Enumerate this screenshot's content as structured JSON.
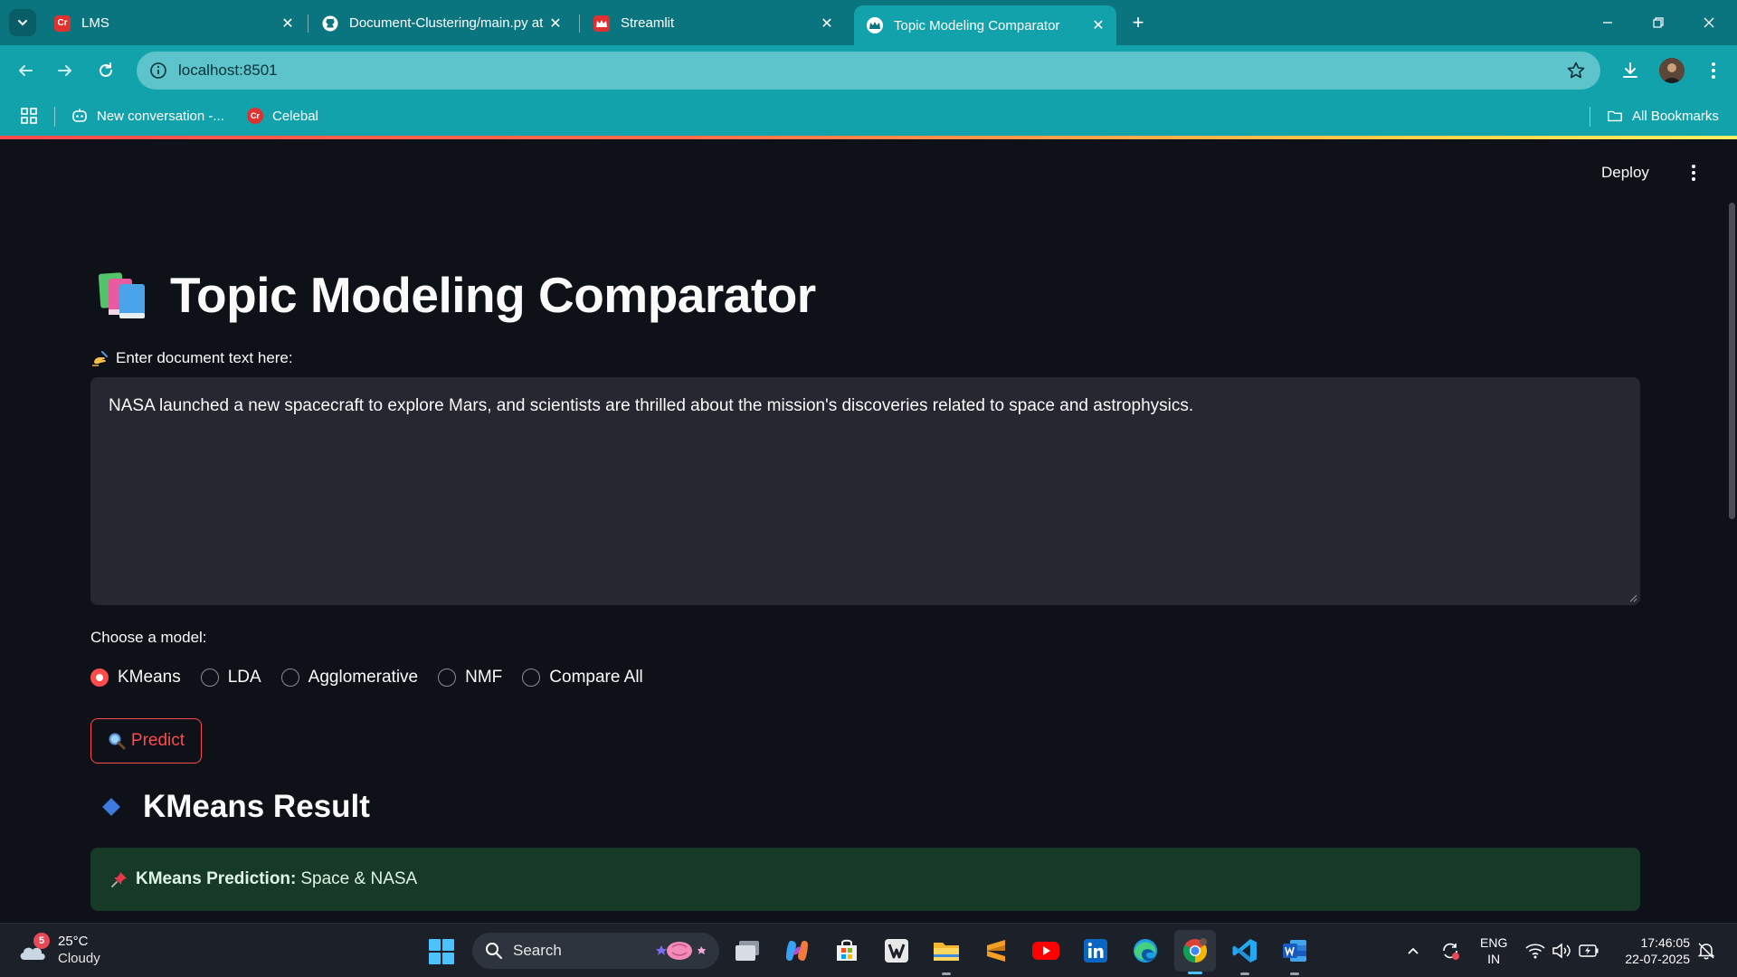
{
  "browser": {
    "tabs": [
      {
        "title": "LMS",
        "active": false
      },
      {
        "title": "Document-Clustering/main.py at",
        "active": false
      },
      {
        "title": "Streamlit",
        "active": false
      },
      {
        "title": "Topic Modeling Comparator",
        "active": true
      }
    ],
    "url": "localhost:8501",
    "bookmarks": [
      {
        "label": "New conversation -..."
      },
      {
        "label": "Celebal"
      }
    ],
    "all_bookmarks_label": "All Bookmarks",
    "favicon_text": "Cr"
  },
  "app": {
    "deploy_label": "Deploy",
    "title": "Topic Modeling Comparator",
    "input_label": "Enter document text here:",
    "input_value": "NASA launched a new spacecraft to explore Mars, and scientists are thrilled about the mission's discoveries related to space and astrophysics.",
    "model_label": "Choose a model:",
    "models": [
      "KMeans",
      "LDA",
      "Agglomerative",
      "NMF",
      "Compare All"
    ],
    "selected_model": "KMeans",
    "predict_label": "Predict",
    "result_heading": "KMeans Result",
    "prediction_label": "KMeans Prediction:",
    "prediction_value": "Space & NASA"
  },
  "taskbar": {
    "weather_badge": "5",
    "temperature": "25°C",
    "condition": "Cloudy",
    "search_label": "Search",
    "lang_line1": "ENG",
    "lang_line2": "IN",
    "time": "17:46:05",
    "date": "22-07-2025"
  },
  "colors": {
    "accent": "#ff4b4b",
    "chrome": "#12a2ab",
    "tabstrip": "#0a747f",
    "app_bg": "#0e1117",
    "input_bg": "#262730",
    "success_bg": "#173928"
  }
}
